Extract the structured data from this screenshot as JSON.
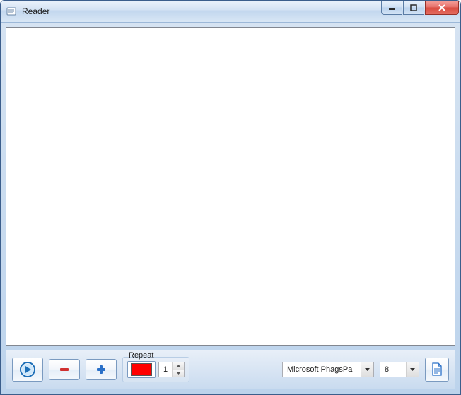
{
  "window": {
    "title": "Reader"
  },
  "textarea": {
    "value": ""
  },
  "toolbar": {
    "repeat": {
      "label": "Repeat",
      "color": "#ff0000",
      "count": "1"
    },
    "font": {
      "selected": "Microsoft PhagsPa"
    },
    "size": {
      "selected": "8"
    }
  }
}
